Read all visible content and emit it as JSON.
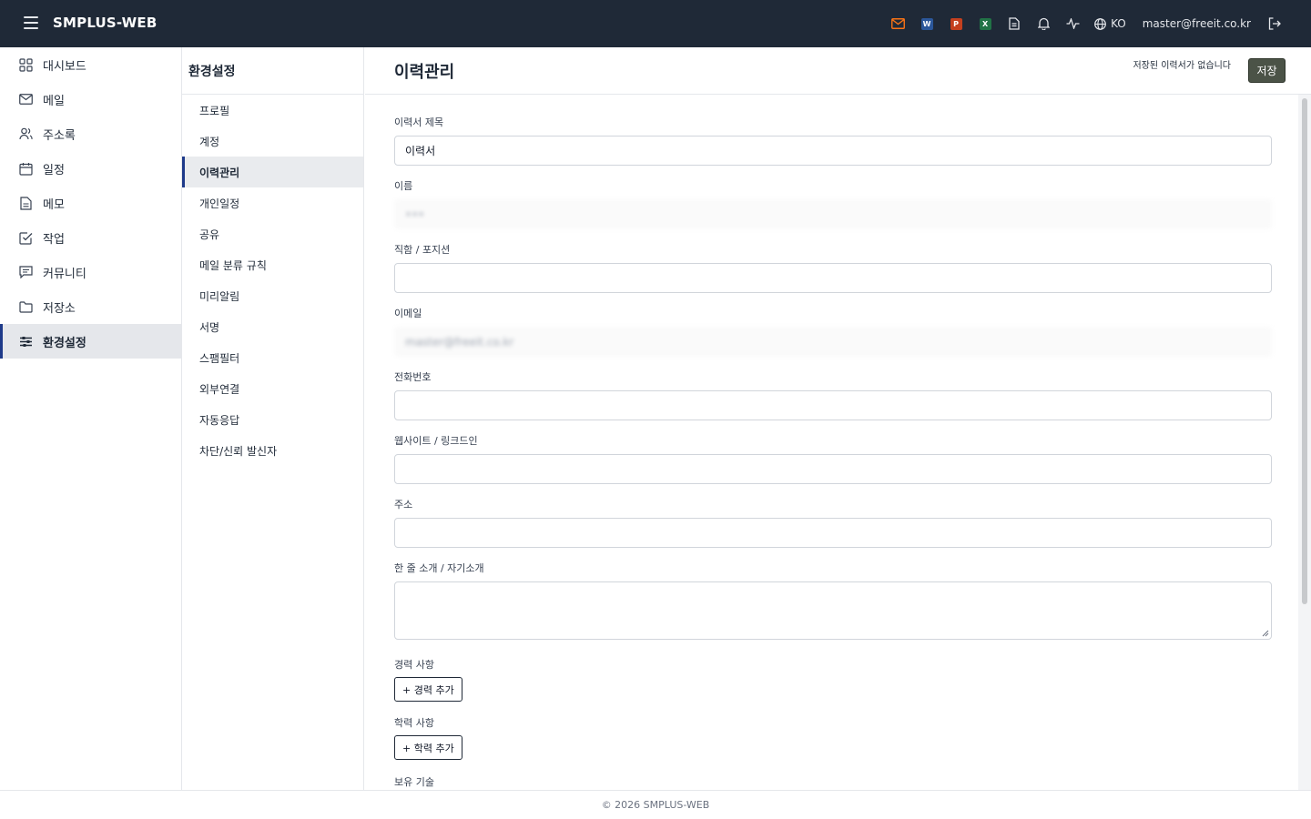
{
  "app": {
    "brand": "SMPLUS-WEB"
  },
  "topbar": {
    "icons": [
      "menu-icon",
      "mail-icon",
      "word-icon",
      "powerpoint-icon",
      "excel-icon",
      "document-icon",
      "bell-icon",
      "activity-icon",
      "globe-icon",
      "logout-icon"
    ],
    "apps": {
      "word": "W",
      "powerpoint": "P",
      "excel": "X"
    },
    "language": "KO",
    "user_email": "master@freeit.co.kr"
  },
  "leftnav": {
    "items": [
      {
        "label": "대시보드",
        "icon": "grid-icon"
      },
      {
        "label": "메일",
        "icon": "mail-icon"
      },
      {
        "label": "주소록",
        "icon": "contacts-icon"
      },
      {
        "label": "일정",
        "icon": "calendar-icon"
      },
      {
        "label": "메모",
        "icon": "memo-icon"
      },
      {
        "label": "작업",
        "icon": "task-icon"
      },
      {
        "label": "커뮤니티",
        "icon": "community-icon"
      },
      {
        "label": "저장소",
        "icon": "folder-icon"
      },
      {
        "label": "환경설정",
        "icon": "settings-sliders-icon",
        "active": true
      }
    ]
  },
  "subnav": {
    "title": "환경설정",
    "items": [
      {
        "label": "프로필"
      },
      {
        "label": "계정"
      },
      {
        "label": "이력관리",
        "active": true
      },
      {
        "label": "개인일정"
      },
      {
        "label": "공유"
      },
      {
        "label": "메일 분류 규칙"
      },
      {
        "label": "미리알림"
      },
      {
        "label": "서명"
      },
      {
        "label": "스팸필터"
      },
      {
        "label": "외부연결"
      },
      {
        "label": "자동응답"
      },
      {
        "label": "차단/신뢰 발신자"
      }
    ]
  },
  "main": {
    "title": "이력관리",
    "save_status": "저장된 이력서가 없습니다",
    "save_label": "저장",
    "fields": {
      "resume_title": {
        "label": "이력서 제목",
        "value": "이력서"
      },
      "name": {
        "label": "이름",
        "value": "•••"
      },
      "position": {
        "label": "직함 / 포지션",
        "value": ""
      },
      "email": {
        "label": "이메일",
        "value": "master@freeit.co.kr"
      },
      "phone": {
        "label": "전화번호",
        "value": ""
      },
      "website": {
        "label": "웹사이트 / 링크드인",
        "value": ""
      },
      "address": {
        "label": "주소",
        "value": ""
      },
      "intro": {
        "label": "한 줄 소개 / 자기소개",
        "value": ""
      }
    },
    "career": {
      "label": "경력 사항",
      "add_label": "+ 경력 추가"
    },
    "education": {
      "label": "학력 사항",
      "add_label": "+ 학력 추가"
    },
    "skills": {
      "label": "보유 기술"
    }
  },
  "footer": {
    "text": "© 2026 SMPLUS-WEB"
  },
  "colors": {
    "topbar": "#1f2937",
    "accent": "#1e3a8a",
    "save_button": "#4b5347"
  }
}
